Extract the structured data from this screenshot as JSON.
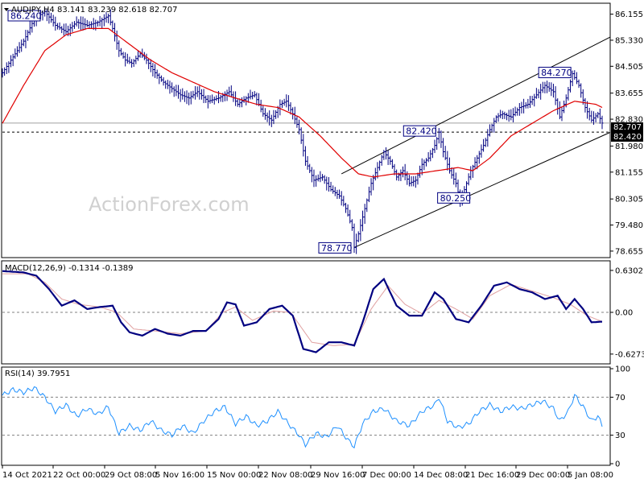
{
  "watermark": "ActionForex.com",
  "price_panel": {
    "header": "AUDJPY,H4  83.141 83.239 82.618 82.707",
    "current_price_label": "82.707",
    "support_label": "82.420"
  },
  "macd_panel": {
    "header": "MACD(12,26,9) -0.1314 -0.1389"
  },
  "rsi_panel": {
    "header": "RSI(14) 39.7951"
  },
  "colors": {
    "bars": "#000080",
    "ma": "#e00000",
    "macd_line": "#000080",
    "signal_line": "#e0a0a0",
    "rsi_line": "#1e90ff",
    "channel": "#000000",
    "grid_dash": "#808080",
    "annotation": "#000080"
  },
  "chart_data": [
    {
      "type": "ohlc",
      "title": "AUDJPY,H4",
      "ohlc_header": {
        "open": 83.141,
        "high": 83.239,
        "low": 82.618,
        "close": 82.707
      },
      "x_tick_labels": [
        "14 Oct 2021",
        "22 Oct 00:00",
        "29 Oct 08:00",
        "5 Nov 16:00",
        "15 Nov 00:00",
        "22 Nov 08:00",
        "29 Nov 16:00",
        "7 Dec 00:00",
        "14 Dec 08:00",
        "21 Dec 16:00",
        "29 Dec 00:00",
        "5 Jan 08:00"
      ],
      "y_ticks": [
        86.155,
        85.33,
        84.505,
        83.655,
        82.83,
        81.98,
        81.155,
        80.305,
        79.48,
        78.655
      ],
      "ylim": [
        78.5,
        86.45
      ],
      "close_path": [
        [
          0,
          84.3
        ],
        [
          5,
          84.8
        ],
        [
          10,
          85.3
        ],
        [
          15,
          86.0
        ],
        [
          20,
          86.24
        ],
        [
          25,
          85.8
        ],
        [
          30,
          85.6
        ],
        [
          35,
          85.9
        ],
        [
          40,
          85.8
        ],
        [
          45,
          85.9
        ],
        [
          50,
          86.1
        ],
        [
          52,
          85.7
        ],
        [
          55,
          85.0
        ],
        [
          58,
          84.7
        ],
        [
          61,
          84.6
        ],
        [
          65,
          84.9
        ],
        [
          68,
          84.7
        ],
        [
          72,
          84.3
        ],
        [
          76,
          84.0
        ],
        [
          80,
          83.8
        ],
        [
          84,
          83.6
        ],
        [
          88,
          83.5
        ],
        [
          92,
          83.7
        ],
        [
          97,
          83.4
        ],
        [
          102,
          83.5
        ],
        [
          107,
          83.7
        ],
        [
          111,
          83.3
        ],
        [
          115,
          83.5
        ],
        [
          119,
          83.6
        ],
        [
          123,
          83.0
        ],
        [
          127,
          82.8
        ],
        [
          131,
          83.3
        ],
        [
          134,
          83.4
        ],
        [
          137,
          83.0
        ],
        [
          140,
          82.5
        ],
        [
          143,
          81.5
        ],
        [
          147,
          80.9
        ],
        [
          151,
          81.0
        ],
        [
          155,
          80.6
        ],
        [
          159,
          80.4
        ],
        [
          162,
          80.0
        ],
        [
          165,
          79.4
        ],
        [
          166,
          78.77
        ],
        [
          168,
          79.2
        ],
        [
          171,
          80.0
        ],
        [
          174,
          80.8
        ],
        [
          177,
          81.3
        ],
        [
          180,
          81.8
        ],
        [
          183,
          81.5
        ],
        [
          186,
          81.0
        ],
        [
          189,
          81.2
        ],
        [
          192,
          80.8
        ],
        [
          195,
          80.9
        ],
        [
          198,
          81.4
        ],
        [
          201,
          81.6
        ],
        [
          204,
          82.0
        ],
        [
          206,
          82.42
        ],
        [
          208,
          81.8
        ],
        [
          211,
          81.2
        ],
        [
          214,
          80.8
        ],
        [
          216,
          80.25
        ],
        [
          218,
          80.6
        ],
        [
          221,
          81.2
        ],
        [
          224,
          81.6
        ],
        [
          227,
          82.0
        ],
        [
          230,
          82.5
        ],
        [
          233,
          82.9
        ],
        [
          236,
          83.0
        ],
        [
          240,
          82.9
        ],
        [
          244,
          83.2
        ],
        [
          248,
          83.3
        ],
        [
          252,
          83.6
        ],
        [
          256,
          83.9
        ],
        [
          260,
          83.7
        ],
        [
          263,
          82.9
        ],
        [
          266,
          83.5
        ],
        [
          269,
          84.27
        ],
        [
          272,
          83.9
        ],
        [
          275,
          83.2
        ],
        [
          278,
          82.8
        ],
        [
          281,
          83.0
        ],
        [
          283,
          82.707
        ]
      ],
      "ma_path": [
        [
          0,
          82.7
        ],
        [
          10,
          83.9
        ],
        [
          20,
          85.0
        ],
        [
          30,
          85.5
        ],
        [
          40,
          85.7
        ],
        [
          50,
          85.7
        ],
        [
          60,
          85.2
        ],
        [
          70,
          84.7
        ],
        [
          80,
          84.3
        ],
        [
          90,
          84.0
        ],
        [
          100,
          83.7
        ],
        [
          110,
          83.5
        ],
        [
          120,
          83.3
        ],
        [
          130,
          83.2
        ],
        [
          140,
          82.9
        ],
        [
          150,
          82.3
        ],
        [
          160,
          81.6
        ],
        [
          168,
          81.1
        ],
        [
          175,
          81.0
        ],
        [
          185,
          81.1
        ],
        [
          195,
          81.1
        ],
        [
          205,
          81.2
        ],
        [
          215,
          81.3
        ],
        [
          222,
          81.2
        ],
        [
          230,
          81.6
        ],
        [
          240,
          82.3
        ],
        [
          250,
          82.7
        ],
        [
          260,
          83.1
        ],
        [
          270,
          83.4
        ],
        [
          280,
          83.3
        ],
        [
          283,
          83.2
        ]
      ],
      "channel_lower": [
        [
          166,
          78.77
        ],
        [
          283,
          82.3
        ]
      ],
      "channel_upper": [
        [
          160,
          81.1
        ],
        [
          283,
          85.3
        ]
      ],
      "horizontal_lines": [
        {
          "value": 82.42,
          "style": "dashed"
        },
        {
          "value": 82.707,
          "style": "solid"
        }
      ],
      "annotations": [
        {
          "label": "86.240",
          "bar": 4,
          "value": 86.24
        },
        {
          "label": "78.770",
          "bar": 166,
          "value": 78.77
        },
        {
          "label": "82.420",
          "bar": 206,
          "value": 82.42
        },
        {
          "label": "80.250",
          "bar": 216,
          "value": 80.25
        },
        {
          "label": "84.270",
          "bar": 269,
          "value": 84.27
        }
      ]
    },
    {
      "type": "line",
      "title": "MACD(12,26,9) -0.1314 -0.1389",
      "y_ticks": [
        0.6302,
        0.0,
        -0.6273
      ],
      "ylim": [
        -0.75,
        0.75
      ],
      "series": [
        {
          "name": "",
          "points": [
            [
              0,
              0.62
            ],
            [
              10,
              0.6
            ],
            [
              16,
              0.55
            ],
            [
              22,
              0.35
            ],
            [
              28,
              0.1
            ],
            [
              34,
              0.18
            ],
            [
              40,
              0.05
            ],
            [
              46,
              0.08
            ],
            [
              52,
              0.1
            ],
            [
              56,
              -0.15
            ],
            [
              60,
              -0.3
            ],
            [
              66,
              -0.35
            ],
            [
              72,
              -0.25
            ],
            [
              78,
              -0.32
            ],
            [
              84,
              -0.35
            ],
            [
              90,
              -0.28
            ],
            [
              96,
              -0.28
            ],
            [
              102,
              -0.1
            ],
            [
              106,
              0.15
            ],
            [
              110,
              0.12
            ],
            [
              114,
              -0.2
            ],
            [
              120,
              -0.15
            ],
            [
              126,
              0.05
            ],
            [
              132,
              0.1
            ],
            [
              137,
              -0.05
            ],
            [
              142,
              -0.55
            ],
            [
              148,
              -0.6
            ],
            [
              154,
              -0.45
            ],
            [
              160,
              -0.45
            ],
            [
              166,
              -0.5
            ],
            [
              170,
              -0.15
            ],
            [
              175,
              0.35
            ],
            [
              180,
              0.5
            ],
            [
              186,
              0.1
            ],
            [
              192,
              -0.05
            ],
            [
              198,
              -0.05
            ],
            [
              204,
              0.3
            ],
            [
              208,
              0.2
            ],
            [
              214,
              -0.1
            ],
            [
              220,
              -0.15
            ],
            [
              226,
              0.1
            ],
            [
              232,
              0.4
            ],
            [
              238,
              0.45
            ],
            [
              244,
              0.35
            ],
            [
              250,
              0.3
            ],
            [
              256,
              0.2
            ],
            [
              262,
              0.25
            ],
            [
              266,
              0.05
            ],
            [
              270,
              0.2
            ],
            [
              274,
              0.05
            ],
            [
              278,
              -0.15
            ],
            [
              283,
              -0.14
            ]
          ]
        },
        {
          "name": "",
          "points": [
            [
              0,
              0.58
            ],
            [
              12,
              0.58
            ],
            [
              20,
              0.45
            ],
            [
              28,
              0.2
            ],
            [
              36,
              0.12
            ],
            [
              46,
              0.08
            ],
            [
              54,
              0.0
            ],
            [
              62,
              -0.25
            ],
            [
              72,
              -0.28
            ],
            [
              84,
              -0.32
            ],
            [
              96,
              -0.28
            ],
            [
              104,
              0.0
            ],
            [
              110,
              0.08
            ],
            [
              118,
              -0.12
            ],
            [
              128,
              0.02
            ],
            [
              136,
              0.0
            ],
            [
              146,
              -0.45
            ],
            [
              156,
              -0.5
            ],
            [
              166,
              -0.48
            ],
            [
              174,
              0.05
            ],
            [
              182,
              0.4
            ],
            [
              190,
              0.12
            ],
            [
              198,
              -0.02
            ],
            [
              206,
              0.18
            ],
            [
              214,
              0.05
            ],
            [
              222,
              -0.1
            ],
            [
              230,
              0.25
            ],
            [
              240,
              0.42
            ],
            [
              250,
              0.32
            ],
            [
              260,
              0.22
            ],
            [
              268,
              0.12
            ],
            [
              276,
              -0.05
            ],
            [
              283,
              -0.139
            ]
          ]
        }
      ]
    },
    {
      "type": "line",
      "title": "RSI(14) 39.7951",
      "y_ticks": [
        100,
        70,
        30,
        0
      ],
      "ylim": [
        0,
        100
      ],
      "levels": [
        70,
        30
      ],
      "series": [
        {
          "name": "",
          "points": [
            [
              0,
              72
            ],
            [
              5,
              78
            ],
            [
              10,
              75
            ],
            [
              15,
              80
            ],
            [
              20,
              70
            ],
            [
              25,
              55
            ],
            [
              30,
              62
            ],
            [
              35,
              50
            ],
            [
              40,
              58
            ],
            [
              45,
              52
            ],
            [
              50,
              60
            ],
            [
              52,
              48
            ],
            [
              55,
              32
            ],
            [
              60,
              40
            ],
            [
              65,
              35
            ],
            [
              70,
              45
            ],
            [
              75,
              35
            ],
            [
              80,
              30
            ],
            [
              85,
              40
            ],
            [
              90,
              32
            ],
            [
              95,
              45
            ],
            [
              100,
              55
            ],
            [
              105,
              60
            ],
            [
              110,
              42
            ],
            [
              115,
              50
            ],
            [
              120,
              40
            ],
            [
              125,
              45
            ],
            [
              130,
              55
            ],
            [
              135,
              42
            ],
            [
              140,
              30
            ],
            [
              143,
              20
            ],
            [
              148,
              32
            ],
            [
              153,
              28
            ],
            [
              158,
              40
            ],
            [
              163,
              25
            ],
            [
              166,
              18
            ],
            [
              170,
              42
            ],
            [
              175,
              55
            ],
            [
              180,
              58
            ],
            [
              186,
              45
            ],
            [
              192,
              40
            ],
            [
              198,
              55
            ],
            [
              204,
              62
            ],
            [
              206,
              70
            ],
            [
              210,
              45
            ],
            [
              215,
              38
            ],
            [
              220,
              42
            ],
            [
              225,
              55
            ],
            [
              230,
              62
            ],
            [
              235,
              55
            ],
            [
              240,
              60
            ],
            [
              245,
              58
            ],
            [
              250,
              62
            ],
            [
              255,
              66
            ],
            [
              260,
              58
            ],
            [
              263,
              45
            ],
            [
              267,
              55
            ],
            [
              270,
              72
            ],
            [
              274,
              60
            ],
            [
              278,
              45
            ],
            [
              281,
              50
            ],
            [
              283,
              40
            ]
          ]
        }
      ]
    }
  ]
}
